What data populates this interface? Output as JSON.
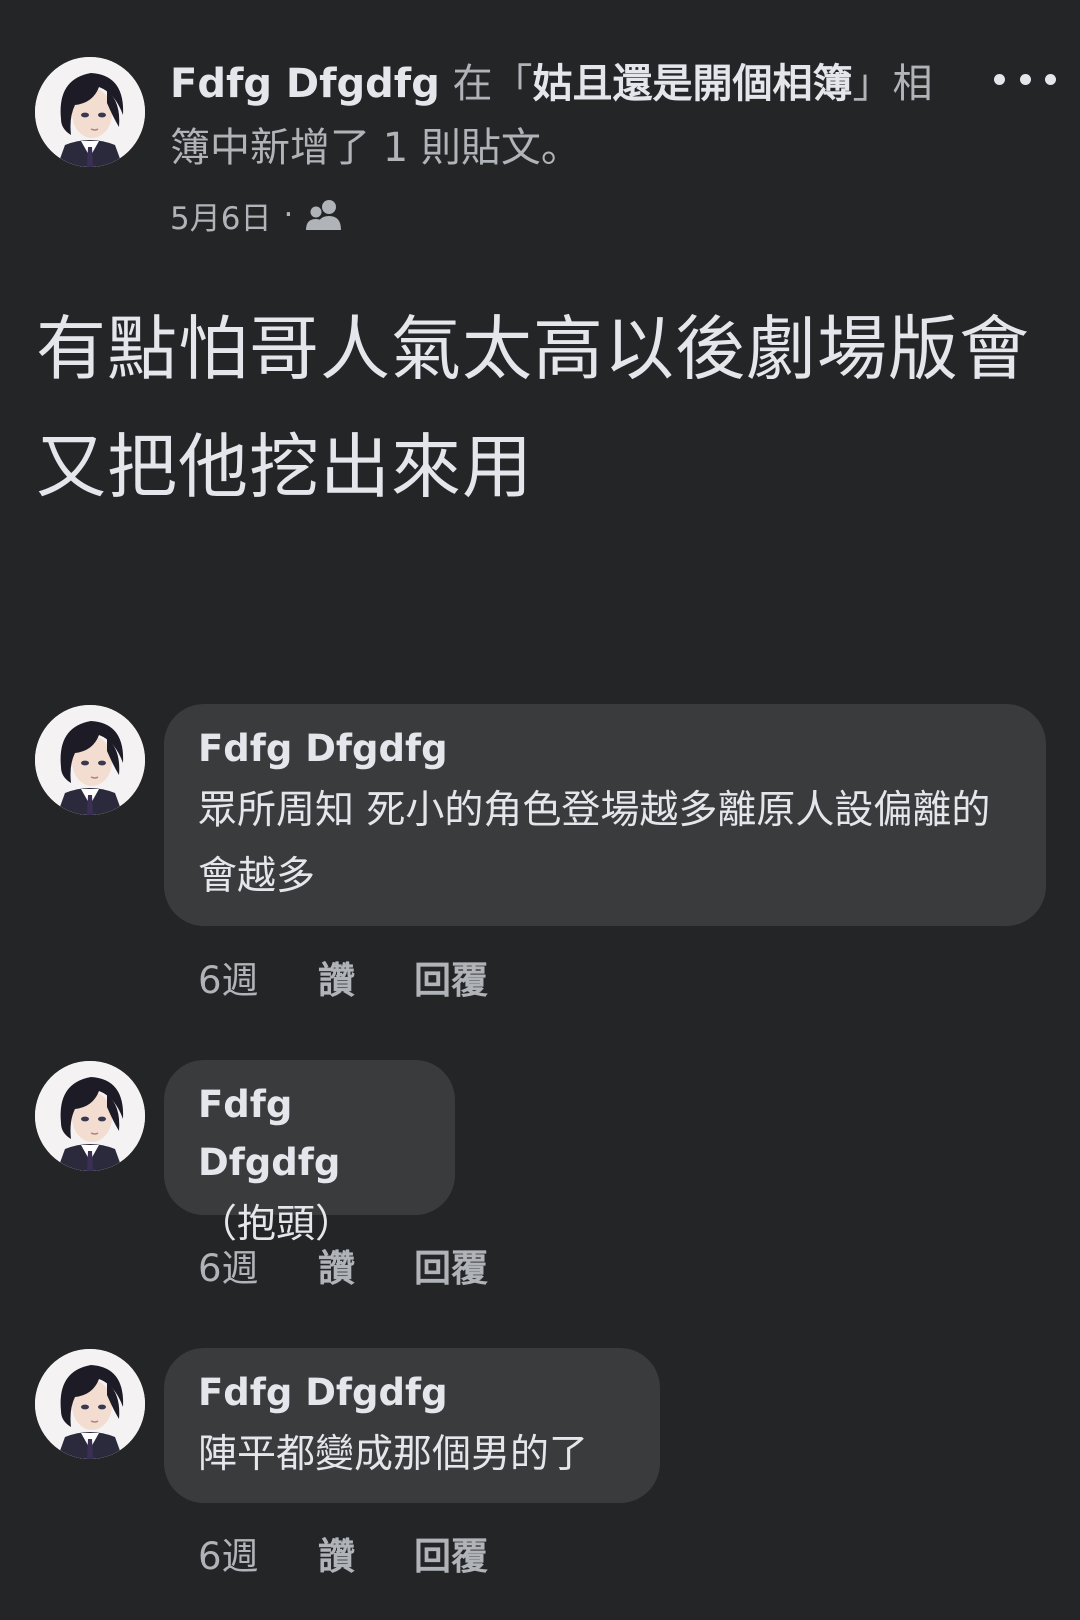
{
  "post": {
    "author": "Fdfg Dfgdfg",
    "action_prefix": " 在「",
    "album_name": "姑且還是開個相簿",
    "action_suffix": "」相簿中新增了 1 則貼文。",
    "date": "5月6日",
    "separator": "·",
    "audience_icon": "friends-icon",
    "more_icon": "more-options-icon",
    "body": "有點怕哥人氣太高以後劇場版會又把他挖出來用"
  },
  "comments": [
    {
      "author": "Fdfg Dfgdfg",
      "text": "眾所周知 死小的角色登場越多離原人設偏離的會越多",
      "time": "6週",
      "like": "讚",
      "reply": "回覆"
    },
    {
      "author": "Fdfg Dfgdfg",
      "text": "（抱頭）",
      "time": "6週",
      "like": "讚",
      "reply": "回覆"
    },
    {
      "author": "Fdfg Dfgdfg",
      "text": "陣平都變成那個男的了",
      "time": "6週",
      "like": "讚",
      "reply": "回覆"
    }
  ],
  "colors": {
    "background": "#242527",
    "bubble": "#3a3b3d",
    "primary_text": "#e4e6eb",
    "secondary_text": "#b0b3b8"
  }
}
